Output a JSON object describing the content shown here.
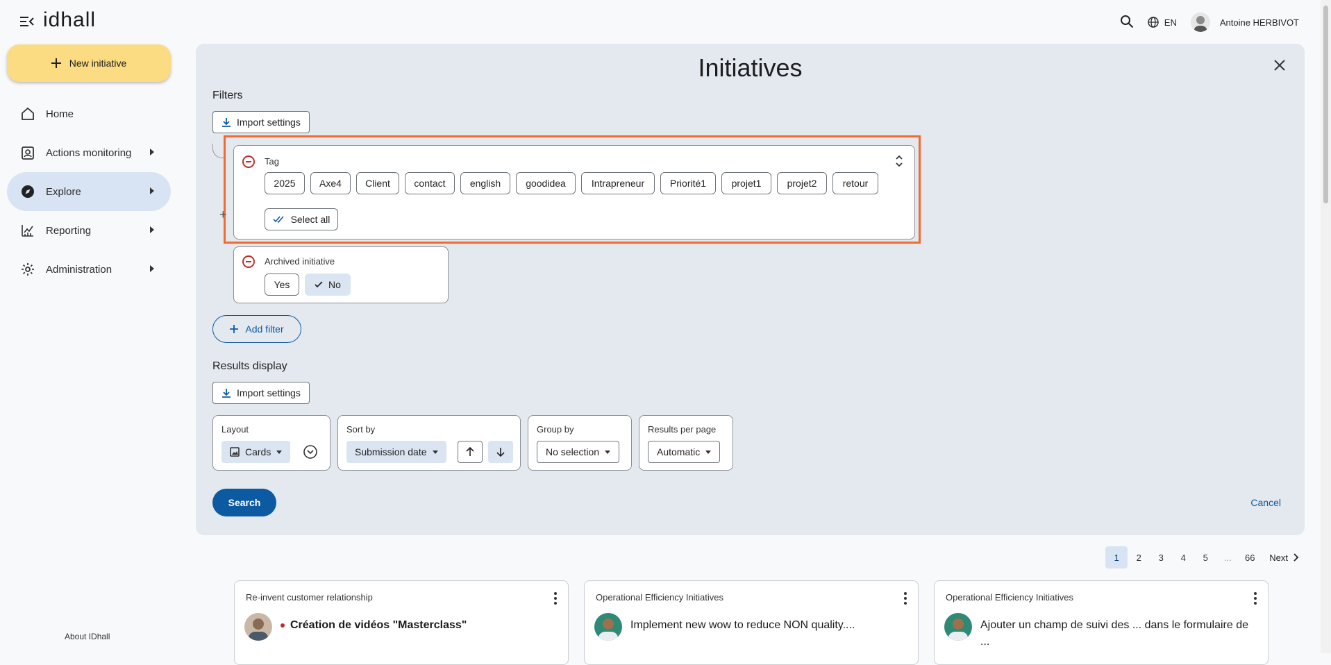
{
  "app": {
    "logo": "idhall"
  },
  "topbar": {
    "language": "EN",
    "user_name": "Antoine HERBIVOT"
  },
  "sidebar": {
    "new_button": "New initiative",
    "items": [
      {
        "label": "Home"
      },
      {
        "label": "Actions monitoring"
      },
      {
        "label": "Explore"
      },
      {
        "label": "Reporting"
      },
      {
        "label": "Administration"
      }
    ],
    "about": "About IDhall"
  },
  "panel": {
    "title": "Initiatives",
    "filters_title": "Filters",
    "import_settings": "Import settings",
    "tag_filter": {
      "label": "Tag",
      "chips": [
        "2025",
        "Axe4",
        "Client",
        "contact",
        "english",
        "goodidea",
        "Intrapreneur",
        "Priorité1",
        "projet1",
        "projet2",
        "retour"
      ],
      "select_all": "Select all"
    },
    "archived_filter": {
      "label": "Archived initiative",
      "yes": "Yes",
      "no": "No"
    },
    "add_filter": "Add filter",
    "results_title": "Results display",
    "import_settings_2": "Import settings",
    "layout": {
      "label": "Layout",
      "value": "Cards"
    },
    "sort": {
      "label": "Sort by",
      "value": "Submission date"
    },
    "group": {
      "label": "Group by",
      "value": "No selection"
    },
    "per_page": {
      "label": "Results per page",
      "value": "Automatic"
    },
    "search": "Search",
    "cancel": "Cancel"
  },
  "pagination": {
    "pages": [
      "1",
      "2",
      "3",
      "4",
      "5"
    ],
    "dots": "...",
    "last": "66",
    "next": "Next",
    "current": "1"
  },
  "cards": [
    {
      "category": "Re-invent customer relationship",
      "title": "Création de vidéos \"Masterclass\""
    },
    {
      "category": "Operational Efficiency Initiatives",
      "title": "Implement new wow to reduce NON quality...."
    },
    {
      "category": "Operational Efficiency Initiatives",
      "title": "Ajouter un champ de suivi des ... dans le formulaire de ..."
    }
  ],
  "colors": {
    "accent": "#0b5aa2",
    "new_button": "#fbdc82",
    "highlight": "#f26a2d",
    "panel_bg": "#e4e8ef",
    "remove": "#c62828"
  }
}
